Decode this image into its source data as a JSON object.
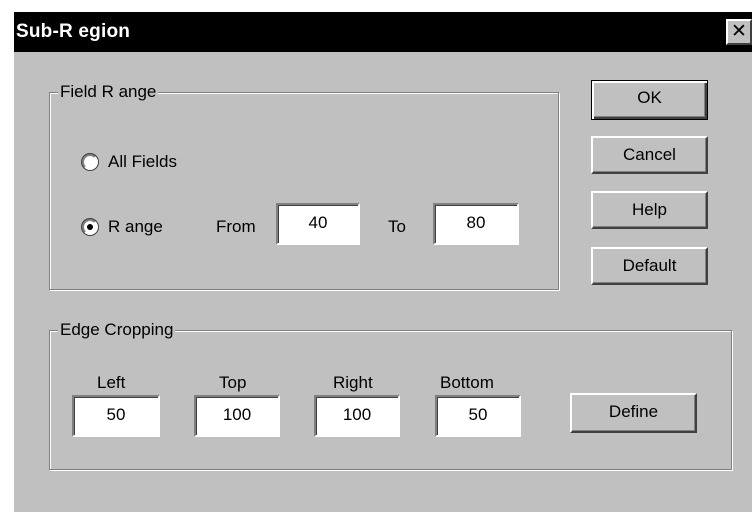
{
  "window": {
    "title": "Sub-R egion",
    "close_glyph": "✕"
  },
  "field_range": {
    "legend": "Field R ange",
    "all_fields_label": "All Fields",
    "range_label": "R ange",
    "from_label": "From",
    "from_value": "40",
    "to_label": "To",
    "to_value": "80",
    "selected": "range"
  },
  "buttons": {
    "ok": "OK",
    "cancel": "Cancel",
    "help": "Help",
    "default": "Default",
    "define": "Define"
  },
  "edge_cropping": {
    "legend": "Edge Cropping",
    "left_label": "Left",
    "left_value": "50",
    "top_label": "Top",
    "top_value": "100",
    "right_label": "Right",
    "right_value": "100",
    "bottom_label": "Bottom",
    "bottom_value": "50"
  },
  "colors": {
    "face": "#c0c0c0",
    "titlebar": "#000000",
    "title_text": "#ffffff"
  }
}
